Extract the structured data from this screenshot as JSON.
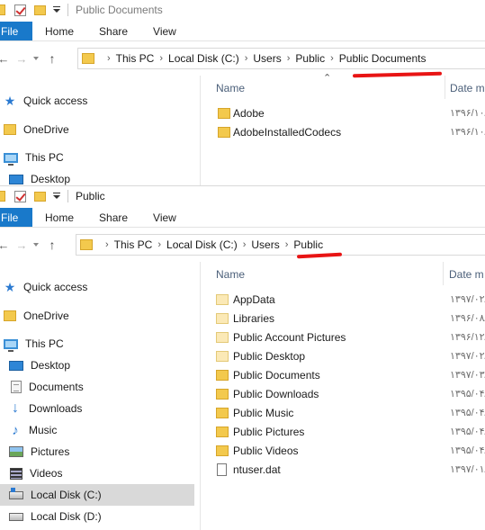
{
  "top_window": {
    "title": "Public Documents",
    "ribbon_tabs": [
      "File",
      "Home",
      "Share",
      "View"
    ],
    "breadcrumbs": [
      "This PC",
      "Local Disk (C:)",
      "Users",
      "Public",
      "Public Documents"
    ],
    "annotation_color": "#e81414",
    "nav": [
      {
        "label": "Quick access",
        "icon": "star-icon"
      },
      {
        "label": "OneDrive",
        "icon": "folder-icon"
      },
      {
        "label": "This PC",
        "icon": "computer-icon"
      },
      {
        "label": "Desktop",
        "icon": "desktop-icon"
      }
    ],
    "columns": {
      "name": "Name",
      "date": "Date m"
    },
    "files": [
      {
        "name": "Adobe",
        "date": "۱۳۹۶/۱۰/",
        "icon": "folder-icon"
      },
      {
        "name": "AdobeInstalledCodecs",
        "date": "۱۳۹۶/۱۰/",
        "icon": "folder-icon"
      }
    ]
  },
  "bottom_window": {
    "title": "Public",
    "ribbon_tabs": [
      "File",
      "Home",
      "Share",
      "View"
    ],
    "breadcrumbs": [
      "This PC",
      "Local Disk (C:)",
      "Users",
      "Public"
    ],
    "annotation_color": "#e81414",
    "nav": [
      {
        "label": "Quick access",
        "icon": "star-icon"
      },
      {
        "label": "OneDrive",
        "icon": "folder-icon"
      },
      {
        "label": "This PC",
        "icon": "computer-icon"
      },
      {
        "label": "Desktop",
        "icon": "desktop-icon"
      },
      {
        "label": "Documents",
        "icon": "documents-icon"
      },
      {
        "label": "Downloads",
        "icon": "downloads-icon"
      },
      {
        "label": "Music",
        "icon": "music-icon"
      },
      {
        "label": "Pictures",
        "icon": "pictures-icon"
      },
      {
        "label": "Videos",
        "icon": "videos-icon"
      },
      {
        "label": "Local Disk (C:)",
        "icon": "drive-c-icon",
        "selected": true
      },
      {
        "label": "Local Disk (D:)",
        "icon": "drive-d-icon"
      }
    ],
    "columns": {
      "name": "Name",
      "date": "Date m"
    },
    "files": [
      {
        "name": "AppData",
        "date": "۱۳۹۷/۰۲/",
        "icon": "folder-pale-icon"
      },
      {
        "name": "Libraries",
        "date": "۱۳۹۶/۰۸/",
        "icon": "folder-pale-icon"
      },
      {
        "name": "Public Account Pictures",
        "date": "۱۳۹۶/۱۲/",
        "icon": "folder-pale-icon"
      },
      {
        "name": "Public Desktop",
        "date": "۱۳۹۷/۰۲/",
        "icon": "folder-pale-icon"
      },
      {
        "name": "Public Documents",
        "date": "۱۳۹۷/۰۳/",
        "icon": "folder-icon"
      },
      {
        "name": "Public Downloads",
        "date": "۱۳۹۵/۰۴/",
        "icon": "folder-icon"
      },
      {
        "name": "Public Music",
        "date": "۱۳۹۵/۰۴/",
        "icon": "folder-icon"
      },
      {
        "name": "Public Pictures",
        "date": "۱۳۹۵/۰۴/",
        "icon": "folder-icon"
      },
      {
        "name": "Public Videos",
        "date": "۱۳۹۵/۰۴/",
        "icon": "folder-icon"
      },
      {
        "name": "ntuser.dat",
        "date": "۱۳۹۷/۰۱/",
        "icon": "file-icon"
      }
    ]
  }
}
